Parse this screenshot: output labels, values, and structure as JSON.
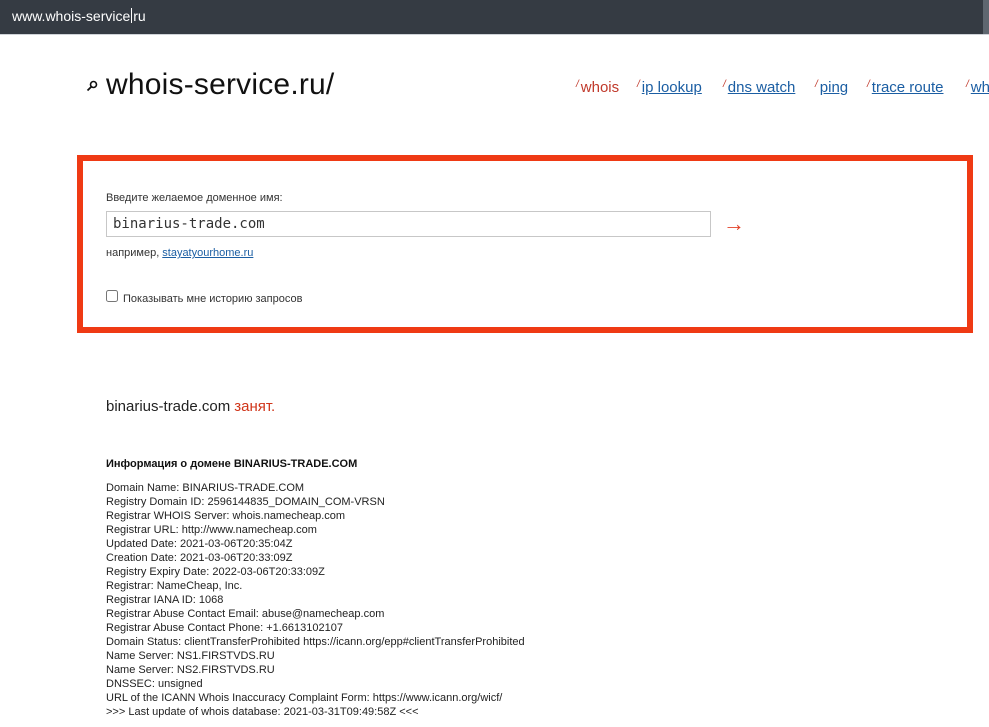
{
  "browser": {
    "url_before_caret": "www.whois-service",
    "url_after_caret": "ru"
  },
  "site": {
    "logo_text": "whois-service.ru/"
  },
  "nav": [
    {
      "label": "whois",
      "active": true
    },
    {
      "label": "ip lookup",
      "active": false
    },
    {
      "label": "dns watch",
      "active": false
    },
    {
      "label": "ping",
      "active": false
    },
    {
      "label": "trace route",
      "active": false
    },
    {
      "label": "wh",
      "active": false
    }
  ],
  "form": {
    "label": "Введите желаемое доменное имя:",
    "input_value": "binarius-trade.com",
    "example_prefix": "например,",
    "example_link": "stayatyourhome.ru",
    "history_checkbox_label": "Показывать мне историю запросов",
    "history_checked": false,
    "submit_symbol": "→",
    "highlight_color": "#ef3a14"
  },
  "result": {
    "domain": "binarius-trade.com",
    "status": "занят."
  },
  "domain_info": {
    "title": "Информация о домене BINARIUS-TRADE.COM",
    "lines": [
      "Domain Name: BINARIUS-TRADE.COM",
      "Registry Domain ID: 2596144835_DOMAIN_COM-VRSN",
      "Registrar WHOIS Server: whois.namecheap.com",
      "Registrar URL: http://www.namecheap.com",
      "Updated Date: 2021-03-06T20:35:04Z",
      "Creation Date: 2021-03-06T20:33:09Z",
      "Registry Expiry Date: 2022-03-06T20:33:09Z",
      "Registrar: NameCheap, Inc.",
      "Registrar IANA ID: 1068",
      "Registrar Abuse Contact Email: abuse@namecheap.com",
      "Registrar Abuse Contact Phone: +1.6613102107",
      "Domain Status: clientTransferProhibited https://icann.org/epp#clientTransferProhibited",
      "Name Server: NS1.FIRSTVDS.RU",
      "Name Server: NS2.FIRSTVDS.RU",
      "DNSSEC: unsigned",
      "URL of the ICANN Whois Inaccuracy Complaint Form: https://www.icann.org/wicf/",
      ">>> Last update of whois database: 2021-03-31T09:49:58Z <<<"
    ]
  }
}
